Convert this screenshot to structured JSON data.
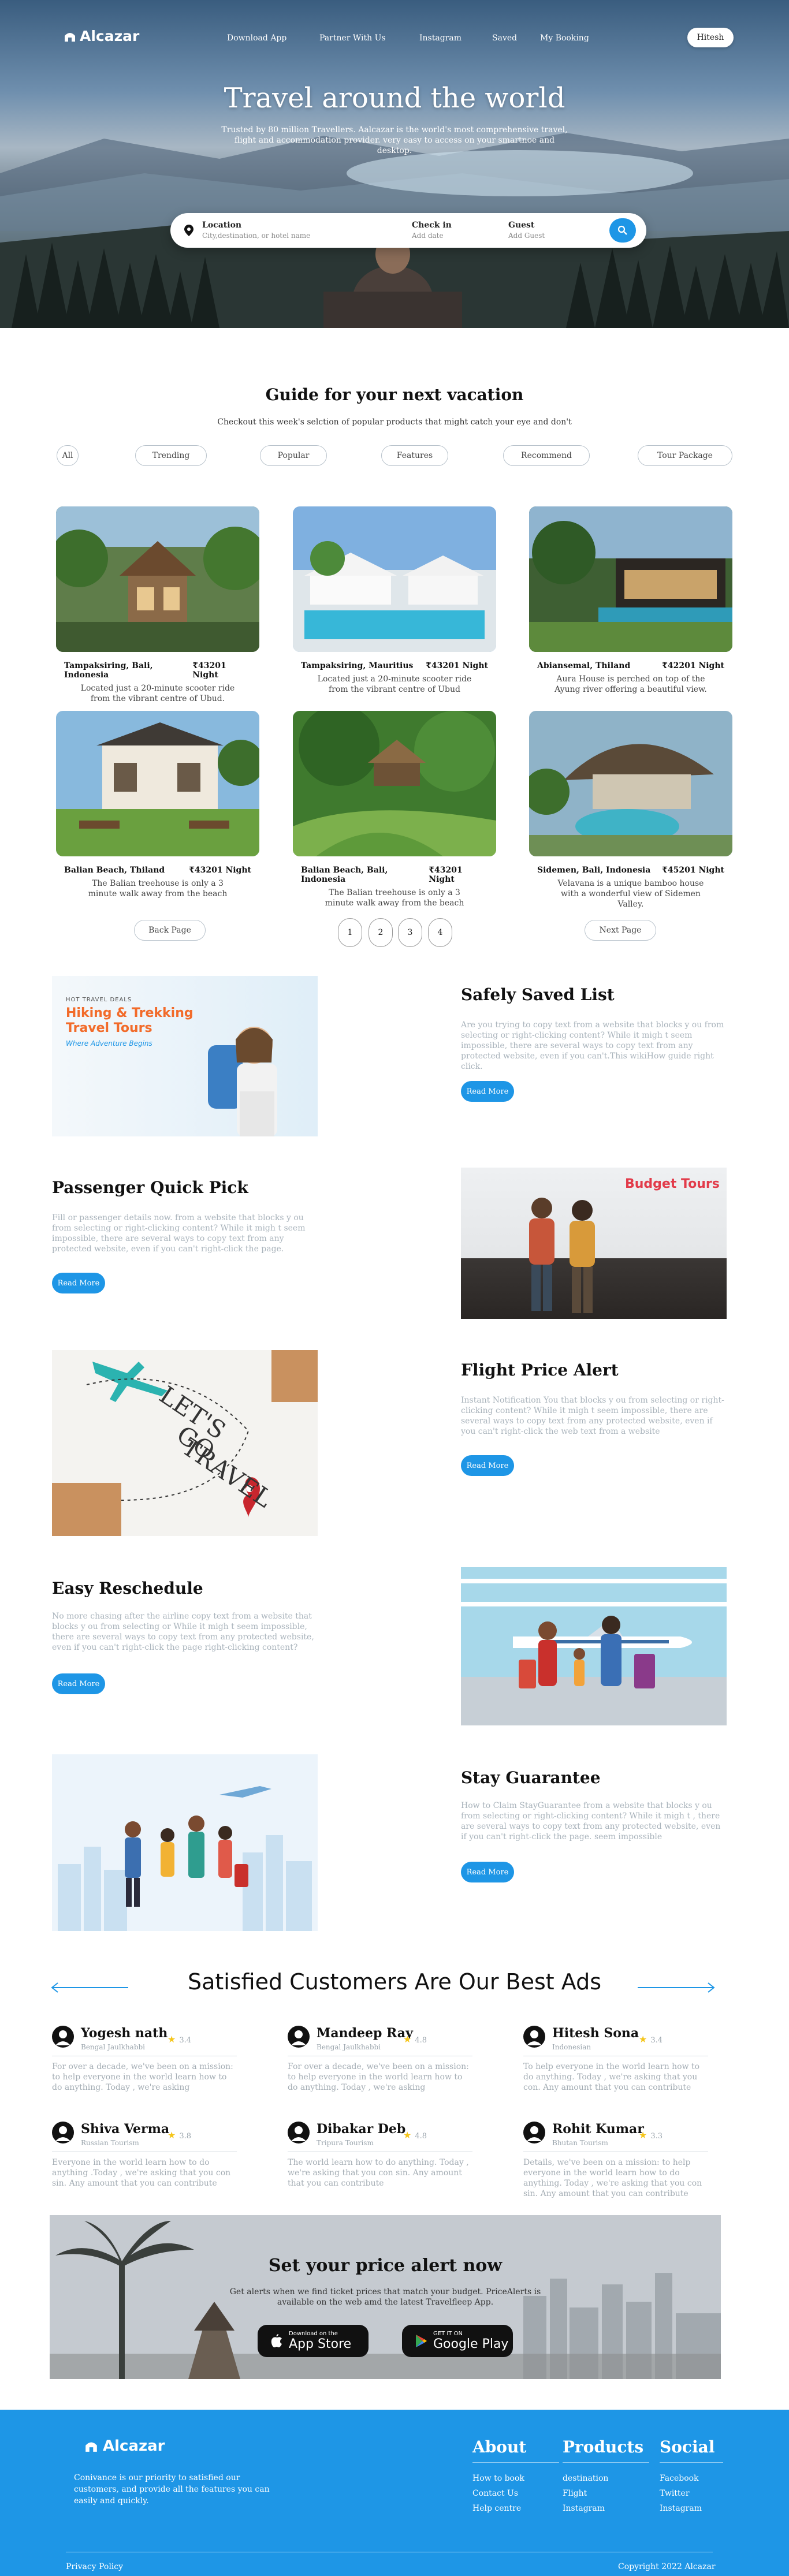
{
  "brand": {
    "name": "Alcazar"
  },
  "nav": {
    "links": [
      "Download App",
      "Partner With Us",
      "Instagram",
      "Saved",
      "My Booking"
    ],
    "user": "Hitesh"
  },
  "hero": {
    "title": "Travel around the world",
    "subtitle": "Trusted by 80 million Travellers. Aalcazar is the world's most comprehensive travel, flight and accommodation provider. very easy to access on your smartnoe and desktop."
  },
  "search": {
    "location_label": "Location",
    "location_placeholder": "City,destination, or hotel name",
    "checkin_label": "Check in",
    "checkin_placeholder": "Add date",
    "guest_label": "Guest",
    "guest_placeholder": "Add Guest",
    "icon": "search-icon"
  },
  "guide": {
    "title": "Guide for your next vacation",
    "subtitle": "Checkout this week's selction of popular products that might catch your eye and don't",
    "filters": [
      "All",
      "Trending",
      "Popular",
      "Features",
      "Recommend",
      "Tour Package"
    ],
    "cards": [
      {
        "place": "Tampaksiring, Bali, Indonesia",
        "price": "₹43201 Night",
        "desc": "Located just a 20-minute scooter ride from the vibrant centre of Ubud."
      },
      {
        "place": "Tampaksiring, Mauritius",
        "price": "₹43201 Night",
        "desc": "Located just a 20-minute scooter ride from the vibrant centre of Ubud"
      },
      {
        "place": "Abiansemal, Thiland",
        "price": "₹42201 Night",
        "desc": "Aura House is perched on top of the Ayung river offering a beautiful view."
      },
      {
        "place": "Balian Beach, Thiland",
        "price": "₹43201 Night",
        "desc": "The Balian treehouse is only a 3 minute walk away from the beach"
      },
      {
        "place": "Balian Beach, Bali, Indonesia",
        "price": "₹43201 Night",
        "desc": "The Balian treehouse is only a 3 minute walk away from the beach"
      },
      {
        "place": "Sidemen, Bali, Indonesia",
        "price": "₹45201 Night",
        "desc": "Velavana is a unique bamboo house with a wonderful view of Sidemen Valley."
      }
    ],
    "pager": {
      "back": "Back Page",
      "next": "Next Page",
      "pages": [
        "1",
        "2",
        "3",
        "4"
      ]
    }
  },
  "features": [
    {
      "title": "Safely Saved List",
      "text": "Are you trying to copy text from a website that blocks y ou from selecting or right-clicking content? While it migh t seem impossible, there are several ways to copy text from any protected website, even if you can't.This wikiHow guide right click.",
      "button": "Read More",
      "image_text": {
        "small": "HOT TRAVEL DEALS",
        "title1": "Hiking & Trekking",
        "title2": "Travel Tours",
        "tag": "Where Adventure Begins"
      }
    },
    {
      "title": "Passenger Quick Pick",
      "text": "Fill or passenger details now. from a website that blocks y ou from selecting or right-clicking content? While it migh t seem impossible, there are several ways to copy text from any protected website, even if you can't right-click the page.",
      "button": "Read More",
      "image_text": {
        "title": "Budget Tours"
      }
    },
    {
      "title": "Flight Price Alert",
      "text": "Instant Notification You that blocks y ou from selecting or right-clicking content? While it migh t seem impossible, there are several ways to copy text from any protected website, even if you can't right-click the web text from a website",
      "button": "Read More",
      "image_text": {
        "l1": "LET'S",
        "l2": "GO",
        "l3": "TRAVEL"
      }
    },
    {
      "title": "Easy Reschedule",
      "text": "No more chasing after the airline copy text from a website that blocks y ou from selecting or While it migh t seem impossible, there are several ways to copy text from any protected website, even if you can't right-click the page right-clicking content?",
      "button": "Read More"
    },
    {
      "title": "Stay Guarantee",
      "text": "How to Claim StayGuarantee from a website that blocks y ou from selecting or right-clicking content? While it migh t , there are several ways to copy text from any protected website, even if you can't right-click the page. seem impossible",
      "button": "Read More"
    }
  ],
  "testimonials": {
    "title": "Satisfied Customers Are Our Best Ads",
    "items": [
      {
        "name": "Yogesh nath",
        "loc": "Bengal Jaulkhabbi",
        "rating": "3.4",
        "text": "For over a decade, we've been on a mission: to help everyone in the world learn how to do anything. Today , we're asking"
      },
      {
        "name": "Mandeep Ray",
        "loc": "Bengal Jaulkhabbi",
        "rating": "4.8",
        "text": "For over a decade, we've been on a mission: to help everyone in the world learn how to do anything. Today , we're asking"
      },
      {
        "name": "Hitesh Sona",
        "loc": "Indonesian",
        "rating": "3.4",
        "text": "To help everyone in the world learn how to do anything. Today , we're asking that you con. Any amount that you can contribute"
      },
      {
        "name": "Shiva Verma",
        "loc": "Russian Tourism",
        "rating": "3.8",
        "text": "Everyone in the world learn how to do anything .Today , we're asking that you con sin. Any amount that you can contribute"
      },
      {
        "name": "Dibakar Deb",
        "loc": "Tripura Tourism",
        "rating": "4.8",
        "text": "The world learn how to do anything. Today , we're asking that you con sin. Any amount that you can contribute"
      },
      {
        "name": "Rohit Kumar",
        "loc": "Bhutan Tourism",
        "rating": "3.3",
        "text": "Details, we've been on a mission: to help everyone in the world learn how to do anything. Today , we're asking that you con sin. Any amount that you can contribute"
      }
    ]
  },
  "alert": {
    "title": "Set your price alert now",
    "text": "Get alerts when we find ticket prices that match your budget. PriceAlerts is available on the web amd the latest Travelfleep App.",
    "appstore_small": "Download on the",
    "appstore_big": "App Store",
    "googleplay_small": "GET IT ON",
    "googleplay_big": "Google Play"
  },
  "footer": {
    "about_text": "Conivance is our priority to satisfied our customers, and provide all the features you can easily and quickly.",
    "cols": [
      {
        "title": "About",
        "links": [
          "How to book",
          "Contact Us",
          "Help centre"
        ]
      },
      {
        "title": "Products",
        "links": [
          "destination",
          "Flight",
          "Instagram"
        ]
      },
      {
        "title": "Social",
        "links": [
          "Facebook",
          "Twitter",
          "Instagram"
        ]
      }
    ],
    "privacy": "Privacy Policy",
    "copyright": "Copyright 2022 Alcazar"
  },
  "colors": {
    "accent": "#1e96e6"
  }
}
